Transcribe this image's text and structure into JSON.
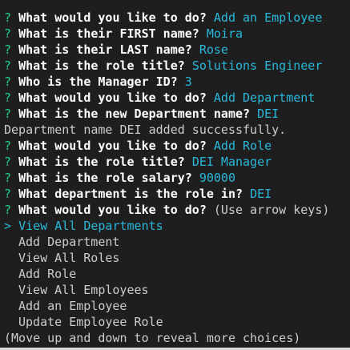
{
  "prompt_symbol": "?",
  "pointer_symbol": ">",
  "history": [
    {
      "question": "What would you like to do?",
      "answer": "Add an Employee"
    },
    {
      "question": "What is their FIRST name?",
      "answer": "Moira"
    },
    {
      "question": "What is their LAST name?",
      "answer": "Rose"
    },
    {
      "question": "What is the role title?",
      "answer": "Solutions Engineer"
    },
    {
      "question": "Who is the Manager ID?",
      "answer": "3"
    },
    {
      "question": "What would you like to do?",
      "answer": "Add Department"
    },
    {
      "question": "What is the new Department name?",
      "answer": "DEI"
    }
  ],
  "message": "Department name DEI added successfully.",
  "history2": [
    {
      "question": "What would you like to do?",
      "answer": "Add Role"
    },
    {
      "question": "What is the role title?",
      "answer": "DEI Manager"
    },
    {
      "question": "What is the role salary?",
      "answer": "90000"
    },
    {
      "question": "What department is the role in?",
      "answer": "DEI"
    }
  ],
  "current_prompt": {
    "question": "What would you like to do?",
    "hint": "(Use arrow keys)"
  },
  "choices": [
    "View All Departments",
    "Add Department",
    "View All Roles",
    "Add Role",
    "View All Employees",
    "Add an Employee",
    "Update Employee Role"
  ],
  "selected_index": 0,
  "footer_hint": "(Move up and down to reveal more choices)",
  "colors": {
    "background": "#1e1e1e",
    "prompt_symbol": "#23d18b",
    "answer": "#29b8db",
    "question": "#ffffff",
    "text": "#cccccc"
  }
}
